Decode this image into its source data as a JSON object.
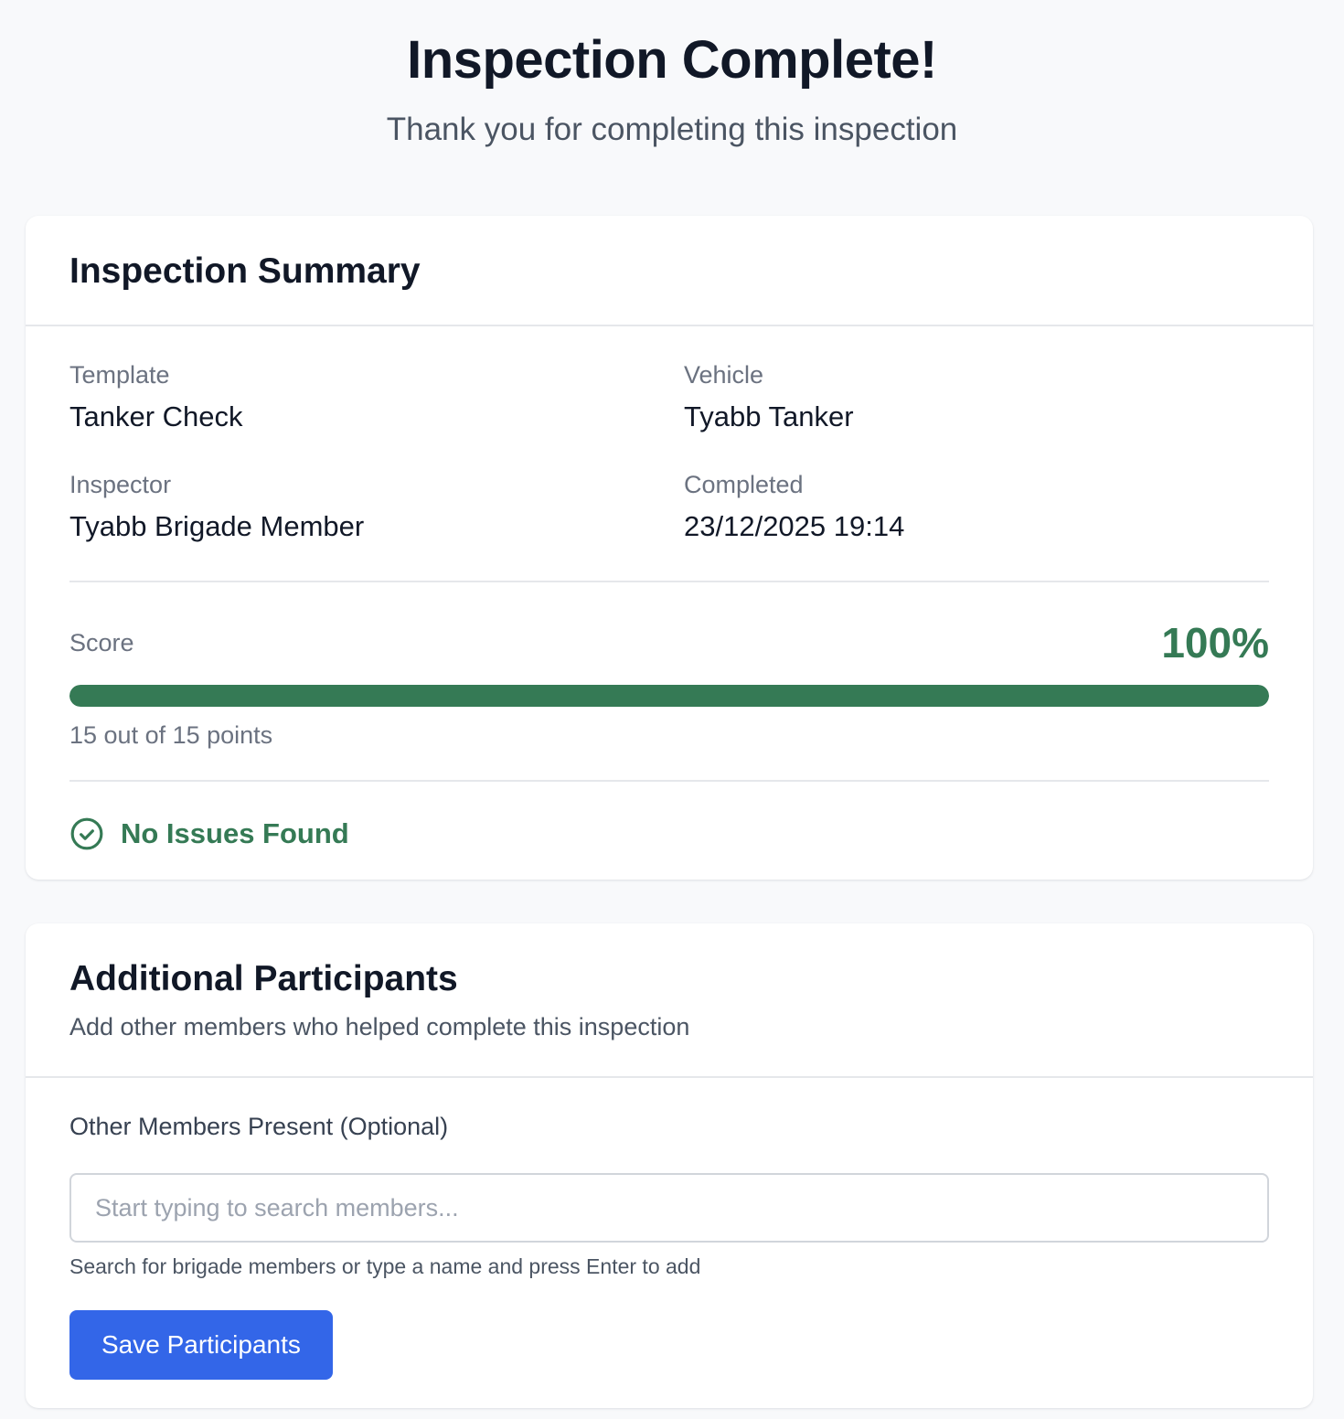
{
  "header": {
    "title": "Inspection Complete!",
    "subtitle": "Thank you for completing this inspection"
  },
  "summary": {
    "title": "Inspection Summary",
    "fields": [
      {
        "label": "Template",
        "value": "Tanker Check"
      },
      {
        "label": "Vehicle",
        "value": "Tyabb Tanker"
      },
      {
        "label": "Inspector",
        "value": "Tyabb Brigade Member"
      },
      {
        "label": "Completed",
        "value": "23/12/2025 19:14"
      }
    ],
    "score": {
      "label": "Score",
      "value": "100%",
      "progress_fraction": 1.0,
      "points_text": "15 out of 15 points"
    },
    "issues": {
      "text": "No Issues Found",
      "icon": "check-circle-icon",
      "color": "#357a55"
    }
  },
  "participants": {
    "title": "Additional Participants",
    "description": "Add other members who helped complete this inspection",
    "field_label": "Other Members Present (Optional)",
    "search": {
      "value": "",
      "placeholder": "Start typing to search members..."
    },
    "help_text": "Search for brigade members or type a name and press Enter to add",
    "save_label": "Save Participants"
  },
  "colors": {
    "accent": "#3366e8",
    "success": "#357a55",
    "background": "#f8f9fb"
  }
}
